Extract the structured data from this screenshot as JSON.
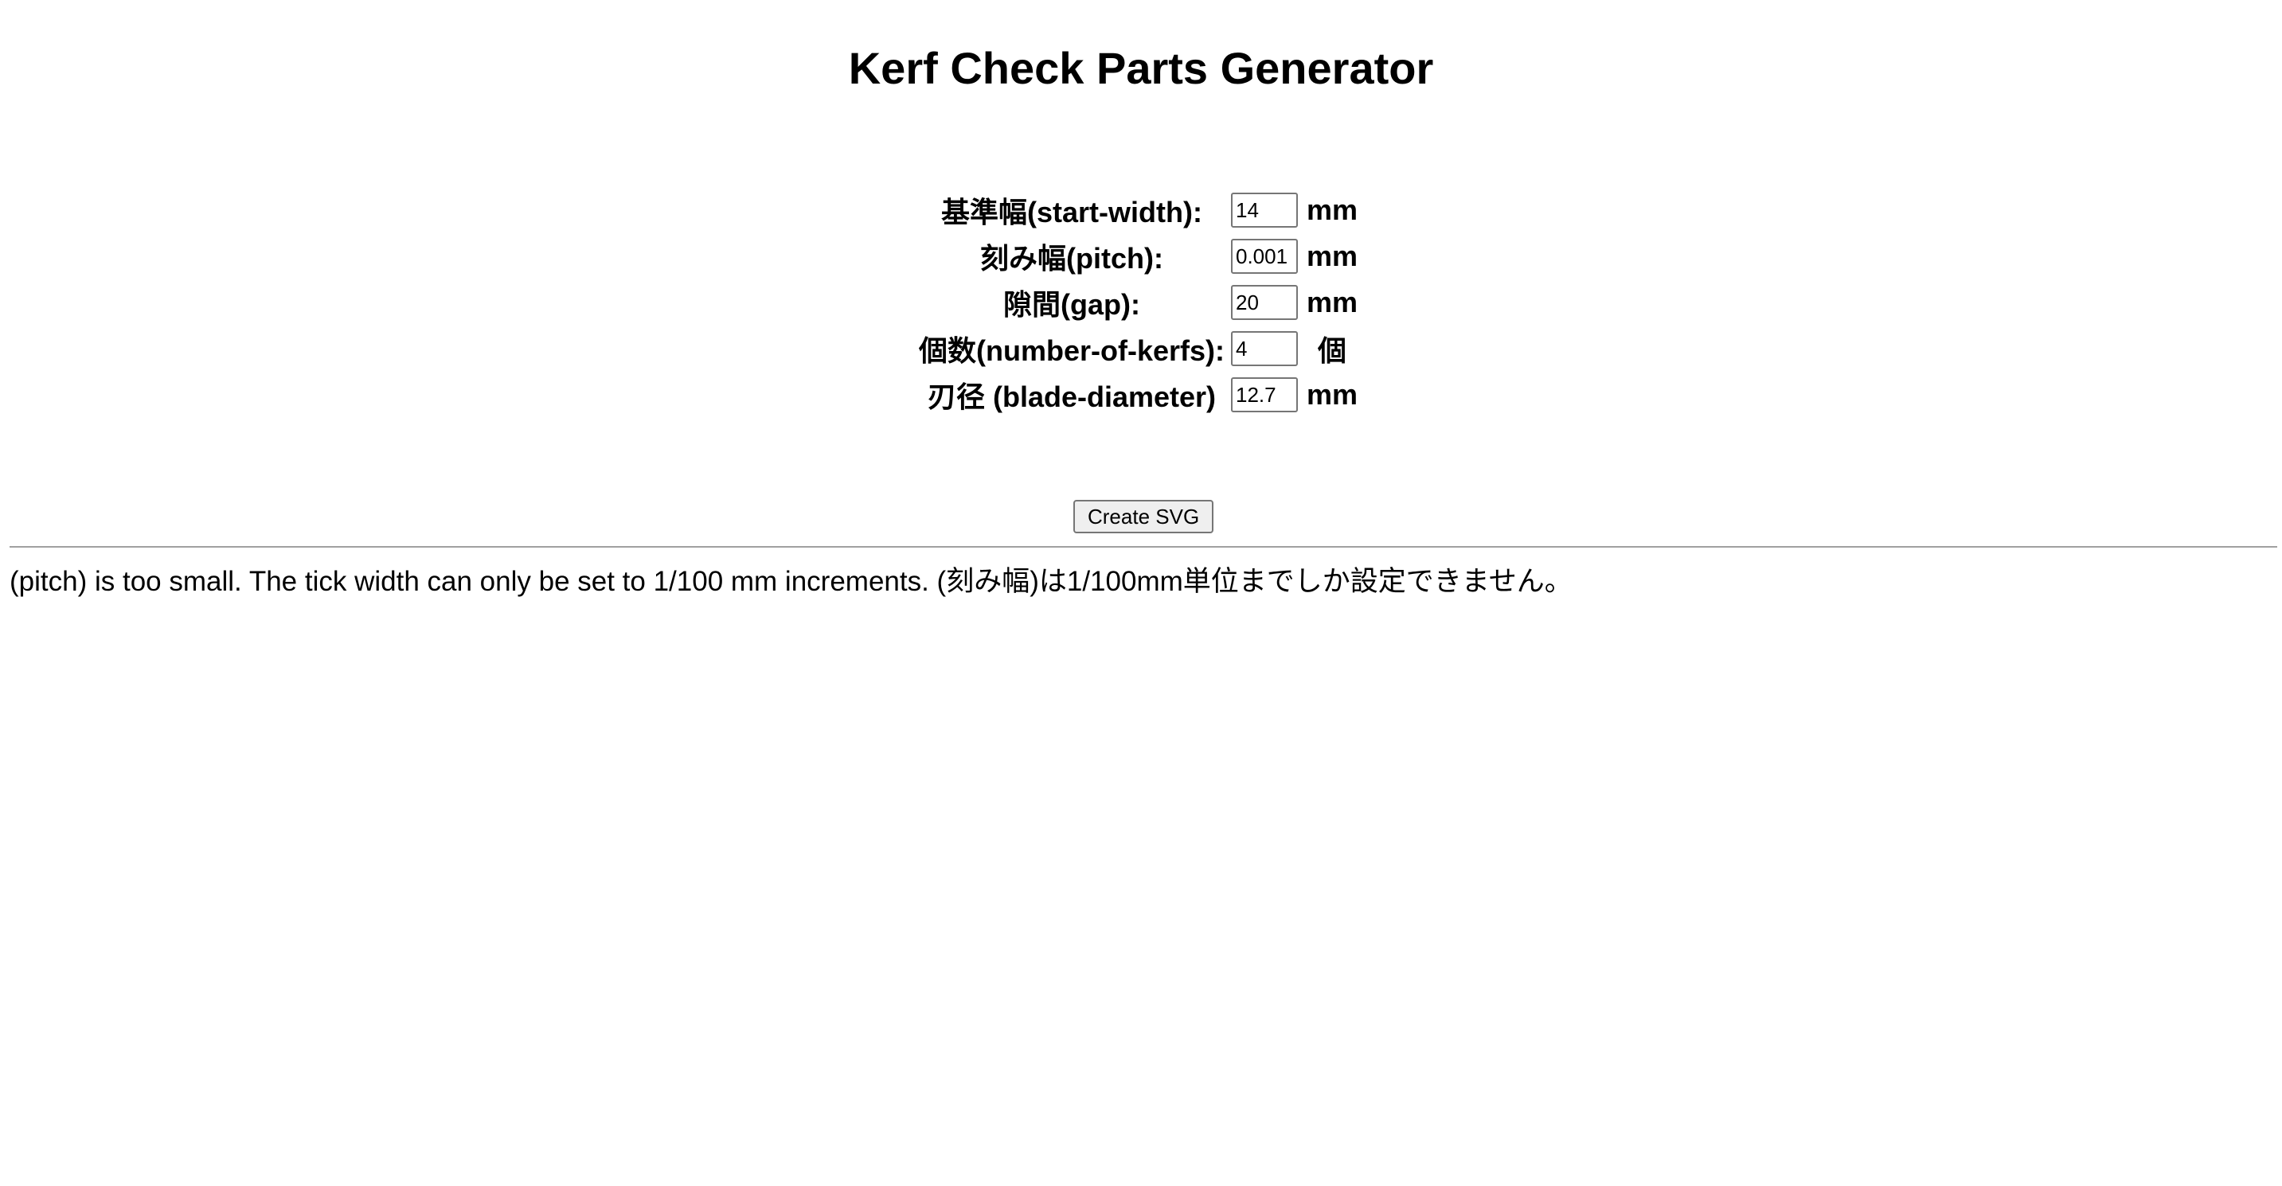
{
  "page": {
    "title": "Kerf Check Parts Generator"
  },
  "form": {
    "fields": [
      {
        "label": "基準幅(start-width):",
        "value": "14",
        "unit": "mm"
      },
      {
        "label": "刻み幅(pitch):",
        "value": "0.001",
        "unit": "mm"
      },
      {
        "label": "隙間(gap):",
        "value": "20",
        "unit": "mm"
      },
      {
        "label": "個数(number-of-kerfs):",
        "value": "4",
        "unit": "個"
      },
      {
        "label": "刃径 (blade-diameter)",
        "value": "12.7",
        "unit": "mm"
      }
    ],
    "submit_label": "Create SVG"
  },
  "message": {
    "text": "(pitch) is too small. The tick width can only be set to 1/100 mm increments. (刻み幅)は1/100mm単位までしか設定できません。"
  }
}
